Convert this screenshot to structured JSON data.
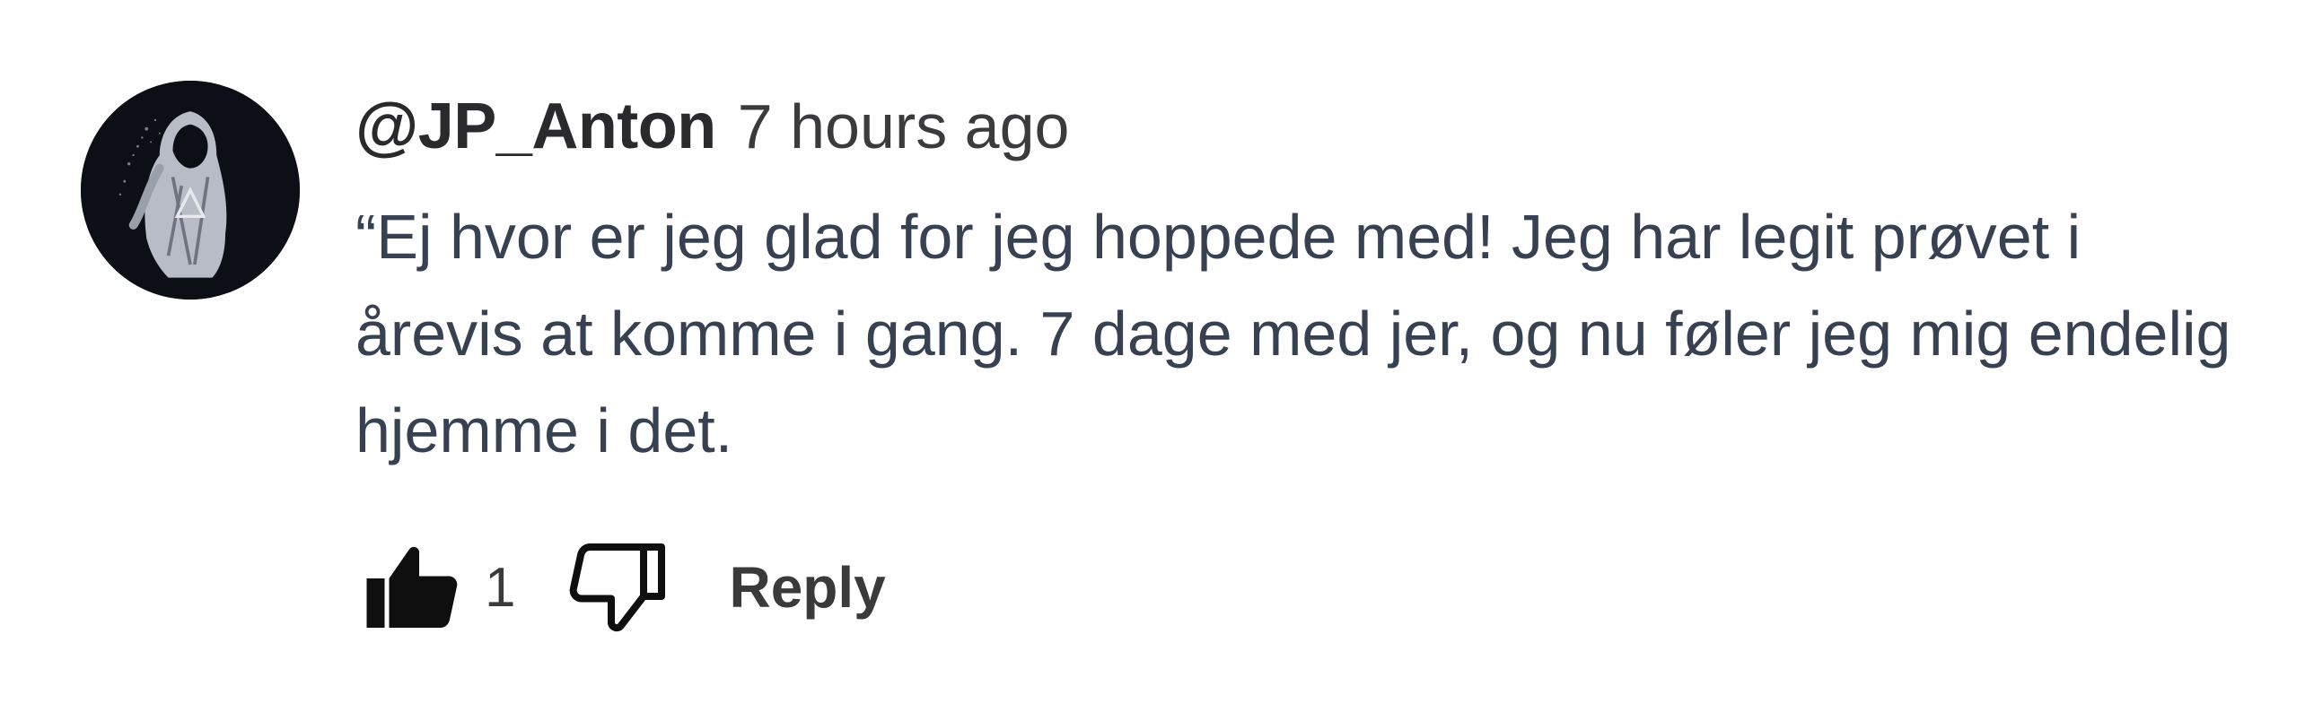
{
  "comment": {
    "username": "@JP_Anton",
    "timestamp": "7 hours ago",
    "text": "“Ej hvor er jeg glad for jeg hoppede med! Jeg har legit prøvet i årevis at komme i gang. 7 dage med jer, og nu føler jeg mig endelig hjemme i det.",
    "avatar_icon": "hooded-figure-avatar"
  },
  "actions": {
    "like_icon": "thumbs-up-filled-icon",
    "like_count": "1",
    "dislike_icon": "thumbs-down-outline-icon",
    "reply_label": "Reply"
  },
  "colors": {
    "username": "#2a2a2c",
    "text": "#384152",
    "avatar_bg": "#0d0f16"
  }
}
